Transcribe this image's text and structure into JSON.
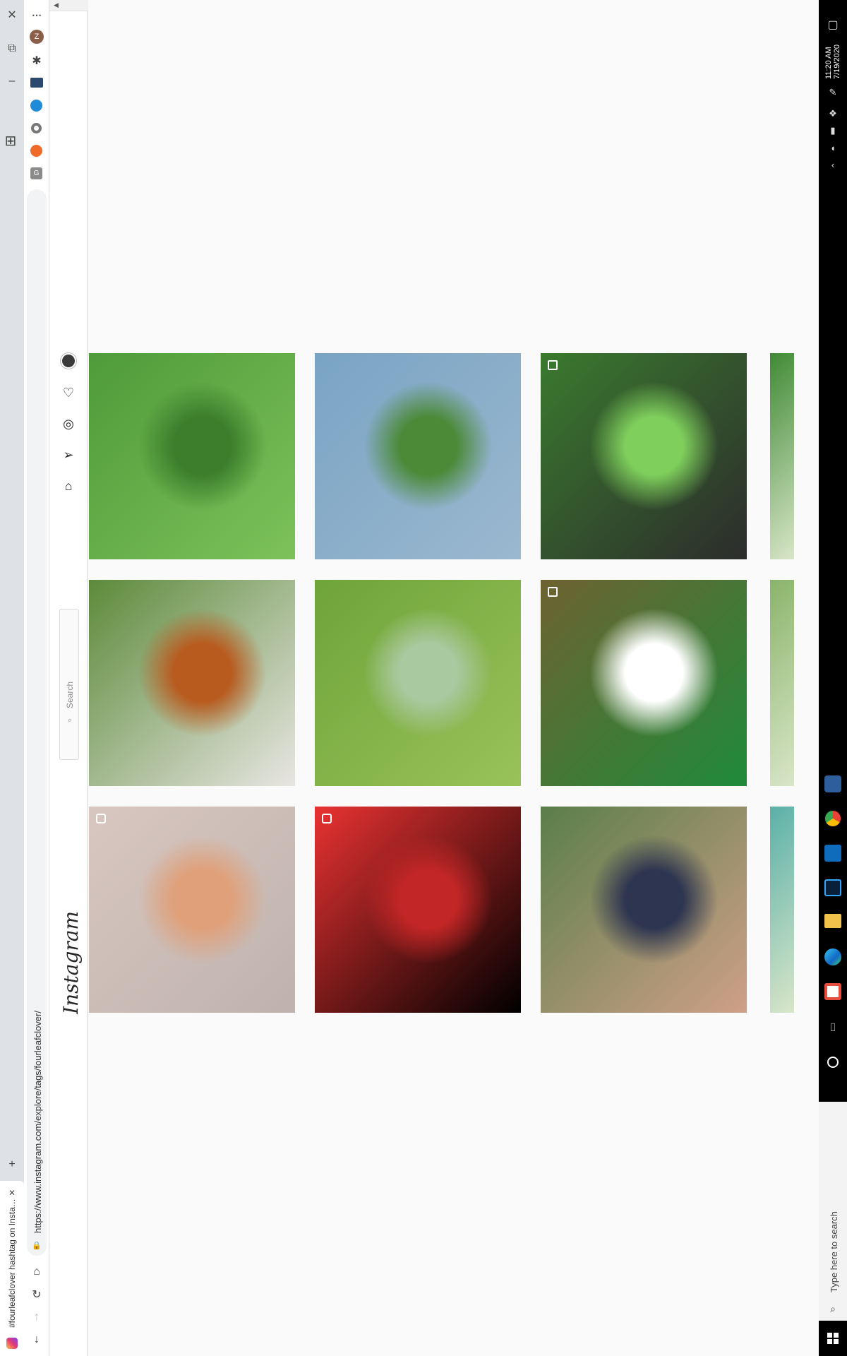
{
  "browser": {
    "tab_title": "#fourleafclover hashtag on Insta…",
    "url": "https://www.instagram.com/explore/tags/fourleafclover/",
    "menu_glyph": "⋯",
    "profile_initial": "Z",
    "new_tab_label": "+",
    "close_label": "✕"
  },
  "instagram": {
    "logo": "Instagram",
    "search_placeholder": "Search",
    "posts": [
      {
        "name": "post-clover-handful",
        "colors": [
          "#4f9a3a",
          "#7dc25a",
          "#3c7e2c"
        ],
        "badge": "none"
      },
      {
        "name": "post-boy-smiling",
        "colors": [
          "#7aa4c4",
          "#9bb8cf",
          "#4c8a38"
        ],
        "badge": "none"
      },
      {
        "name": "post-dog-clover",
        "colors": [
          "#3a7a2e",
          "#2c2c2c",
          "#7fcf5c"
        ],
        "badge": "multi"
      },
      {
        "name": "post-golf-clover",
        "colors": [
          "#5c8a3a",
          "#e8e6e2",
          "#b85b1f"
        ],
        "badge": "none"
      },
      {
        "name": "post-grass-clover",
        "colors": [
          "#6ea43a",
          "#99c25a",
          "#a9c9a0"
        ],
        "badge": "none"
      },
      {
        "name": "post-clover-patch",
        "colors": [
          "#6e6231",
          "#1f8a3a",
          "#ffffff"
        ],
        "badge": "multi"
      },
      {
        "name": "post-bracelets",
        "colors": [
          "#d8c7c0",
          "#bfb2ad",
          "#e0a07a"
        ],
        "badge": "video"
      },
      {
        "name": "post-red-silhouette",
        "colors": [
          "#ea3232",
          "#000000",
          "#c22626"
        ],
        "badge": "video"
      },
      {
        "name": "post-girl-clovers",
        "colors": [
          "#5a7e4a",
          "#cfa088",
          "#2e3550"
        ],
        "badge": "none"
      }
    ],
    "peek_colors": [
      "#3f8a34",
      "#8ab46a",
      "#5ab0a8"
    ]
  },
  "taskbar": {
    "time": "11:20 AM",
    "date": "7/19/2020",
    "search_placeholder": "Type here to search"
  },
  "colors": {
    "ig_bg": "#fafafa",
    "taskbar_bg": "#000000",
    "tabstrip_bg": "#dee1e6"
  }
}
